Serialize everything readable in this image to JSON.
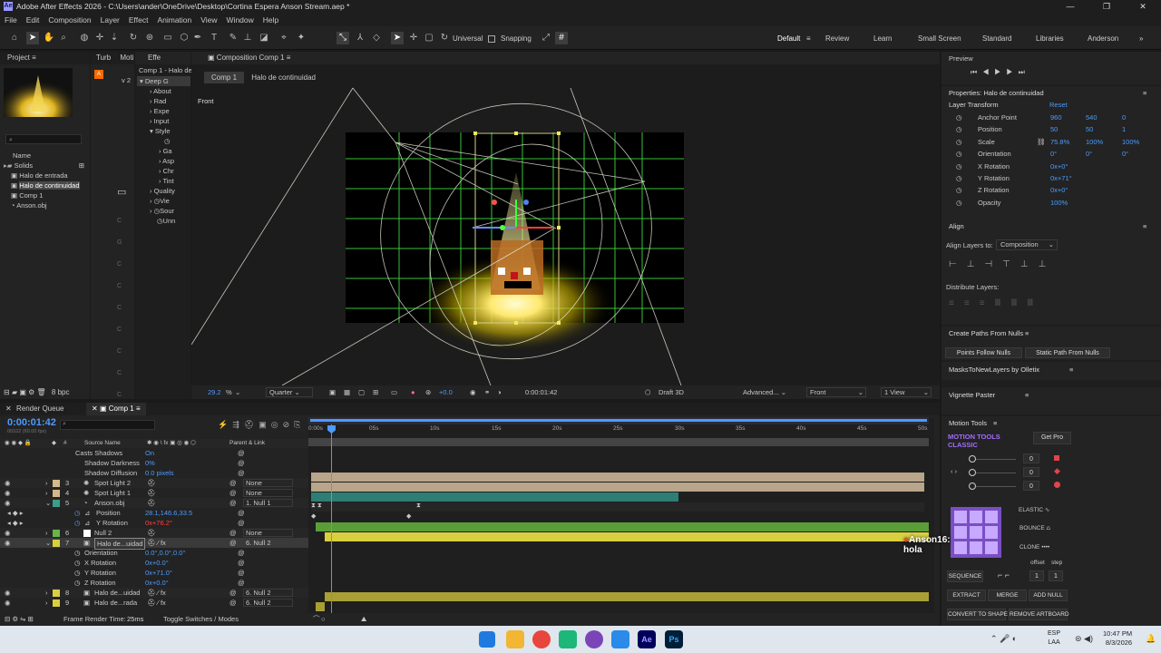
{
  "app": {
    "title": "Adobe After Effects 2026 - C:\\Users\\ander\\OneDrive\\Desktop\\Cortina Espera Anson Stream.aep *",
    "menus": [
      "File",
      "Edit",
      "Composition",
      "Layer",
      "Effect",
      "Animation",
      "View",
      "Window",
      "Help"
    ]
  },
  "toolbar": {
    "universal": "Universal",
    "snapping": "Snapping"
  },
  "workspaces": [
    "Default",
    "Review",
    "Learn",
    "Small Screen",
    "Standard",
    "Libraries",
    "Anderson"
  ],
  "project": {
    "tab": "Project",
    "tab2": "Turb",
    "tab3": "Moti",
    "tab4": "Effe",
    "col_name": "Name",
    "items": [
      "Solids",
      "Halo de entrada",
      "Halo de continuidad",
      "Comp 1",
      "Anson.obj"
    ],
    "bpc": "8 bpc",
    "search_placeholder": ""
  },
  "effects": {
    "header": "Comp 1 - Halo de",
    "v2": "v 2",
    "items": [
      "Deep G",
      "About",
      "Rad",
      "Expe",
      "Input",
      "Style",
      "",
      "Ga",
      "Asp",
      "Chr",
      "Tint",
      "Quality",
      "Vie",
      "Sour",
      "Unn"
    ]
  },
  "composition": {
    "tab": "Composition Comp 1",
    "breadcrumb1": "Comp 1",
    "breadcrumb2": "Halo de continuidad",
    "view_label": "Front",
    "zoom": "29.2",
    "zoom_unit": "%",
    "resolution": "Quarter",
    "exposure": "+0.0",
    "timecode": "0:00:01:42",
    "renderer": "Draft 3D",
    "advanced": "Advanced...",
    "camera": "Front",
    "views": "1 View"
  },
  "preview": {
    "title": "Preview"
  },
  "properties": {
    "title": "Properties: Halo de continuidad",
    "section": "Layer Transform",
    "reset": "Reset",
    "rows": [
      {
        "label": "Anchor Point",
        "v1": "960",
        "v2": "540",
        "v3": "0"
      },
      {
        "label": "Position",
        "v1": "50",
        "v2": "50",
        "v3": "1"
      },
      {
        "label": "Scale",
        "v1": "75.8%",
        "v2": "100%",
        "v3": "100%"
      },
      {
        "label": "Orientation",
        "v1": "0°",
        "v2": "0°",
        "v3": "0°"
      },
      {
        "label": "X Rotation",
        "v1": "0x+0°",
        "v2": "",
        "v3": ""
      },
      {
        "label": "Y Rotation",
        "v1": "0x+71°",
        "v2": "",
        "v3": ""
      },
      {
        "label": "Z Rotation",
        "v1": "0x+0°",
        "v2": "",
        "v3": ""
      },
      {
        "label": "Opacity",
        "v1": "100%",
        "v2": "",
        "v3": ""
      }
    ]
  },
  "align": {
    "title": "Align",
    "align_to_label": "Align Layers to:",
    "align_to": "Composition",
    "distribute": "Distribute Layers:"
  },
  "create_paths": {
    "title": "Create Paths From Nulls",
    "btn1": "Points Follow Nulls",
    "btn2": "Static Path From Nulls"
  },
  "masks": {
    "title": "MasksToNewLayers by Olletix"
  },
  "vignette": {
    "title": "Vignette Paster"
  },
  "motion_tools": {
    "title": "Motion Tools",
    "brand1": "MOTION TOOLS",
    "brand2": "CLASSIC",
    "get_pro": "Get Pro",
    "values": [
      "0",
      "0",
      "0"
    ],
    "elastic": "ELASTIC",
    "bounce": "BOUNCE",
    "clone": "CLONE",
    "offset": "offset",
    "step": "step",
    "sequence": "SEQUENCE",
    "seq_v1": "1",
    "seq_v2": "1",
    "extract": "EXTRACT",
    "merge": "MERGE",
    "add_null": "ADD NULL",
    "convert": "CONVERT TO SHAPE",
    "remove": "REMOVE ARTBOARD"
  },
  "timeline": {
    "tab_rq": "Render Queue",
    "tab_comp": "Comp 1",
    "timecode": "0:00:01:42",
    "subtime": "00102 (60.00 fps)",
    "col_source": "Source Name",
    "col_parent": "Parent & Link",
    "rows": [
      {
        "num": "",
        "name": "Casts Shadows",
        "val": "On",
        "parent": ""
      },
      {
        "num": "",
        "name": "Shadow Darkness",
        "val": "0%",
        "parent": ""
      },
      {
        "num": "",
        "name": "Shadow Diffusion",
        "val": "0.0 pixels",
        "parent": ""
      },
      {
        "num": "3",
        "name": "Spot Light 2",
        "val": "",
        "parent": "None"
      },
      {
        "num": "4",
        "name": "Spot Light 1",
        "val": "",
        "parent": "None"
      },
      {
        "num": "5",
        "name": "Anson.obj",
        "val": "",
        "parent": "1. Null 1"
      },
      {
        "num": "",
        "name": "Position",
        "val": "28.1,146.6,33.5",
        "parent": ""
      },
      {
        "num": "",
        "name": "Y Rotation",
        "val": "0x+76.2°",
        "parent": ""
      },
      {
        "num": "6",
        "name": "Null 2",
        "val": "",
        "parent": "None"
      },
      {
        "num": "7",
        "name": "Halo de...uidad",
        "val": "",
        "parent": "6. Null 2"
      },
      {
        "num": "",
        "name": "Orientation",
        "val": "0.0°,0.0°,0.0°",
        "parent": ""
      },
      {
        "num": "",
        "name": "X Rotation",
        "val": "0x+0.0°",
        "parent": ""
      },
      {
        "num": "",
        "name": "Y Rotation",
        "val": "0x+71.0°",
        "parent": ""
      },
      {
        "num": "",
        "name": "Z Rotation",
        "val": "0x+0.0°",
        "parent": ""
      },
      {
        "num": "8",
        "name": "Halo de...uidad",
        "val": "",
        "parent": "6. Null 2"
      },
      {
        "num": "9",
        "name": "Halo de...rada",
        "val": "",
        "parent": "6. Null 2"
      }
    ],
    "ruler": [
      "0:00s",
      "05s",
      "10s",
      "15s",
      "20s",
      "25s",
      "30s",
      "35s",
      "40s",
      "45s",
      "50s"
    ],
    "frame_render": "Frame Render Time:",
    "frame_render_val": "25ms",
    "toggle": "Toggle Switches / Modes",
    "chat": "Anson16: hola"
  },
  "taskbar": {
    "lang1": "ESP",
    "lang2": "LAA",
    "time": "10:47 PM",
    "date": "8/3/2026"
  }
}
